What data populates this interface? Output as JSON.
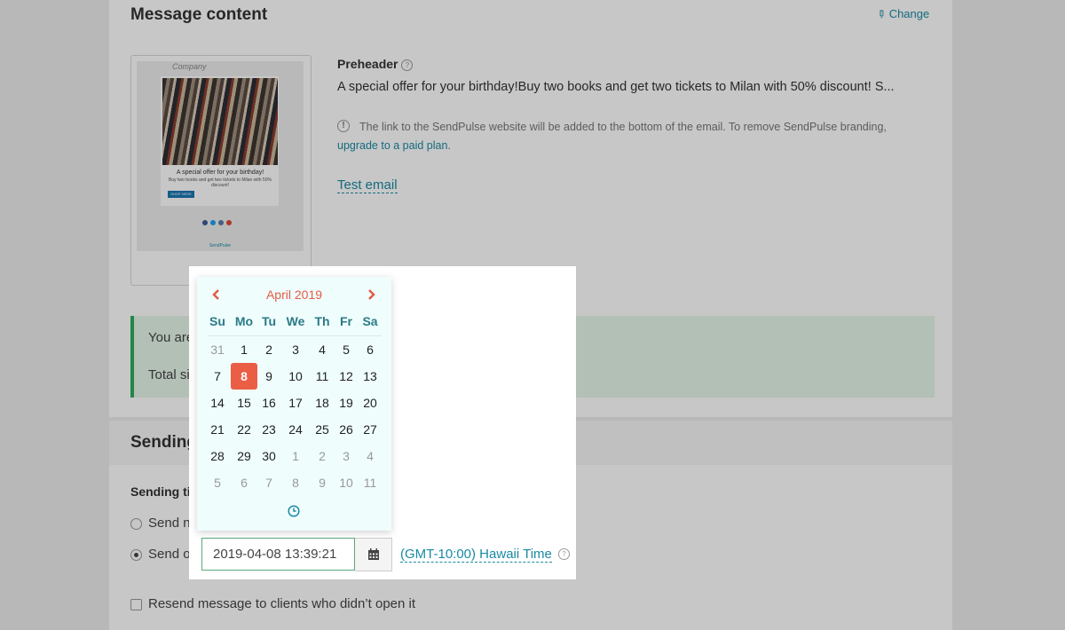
{
  "message_content": {
    "title": "Message content",
    "change_label": "Change",
    "preview": {
      "company": "Company",
      "heading": "A special offer for your birthday!",
      "body": "Buy two books and get two tickets to Milan with 50% discount!",
      "button": "SHOP HERE",
      "brand": "SendPulse"
    },
    "preheader_label": "Preheader",
    "preheader_text": "A special offer for your birthday!Buy two books and get two tickets to Milan with 50% discount! S...",
    "branding_notice": "The link to the SendPulse website will be added to the bottom of the email. To remove SendPulse branding,",
    "upgrade_link": "upgrade to a paid plan",
    "upgrade_suffix": ".",
    "test_email": "Test email"
  },
  "notice_box": {
    "line1": "You are g",
    "line2": "Total siz"
  },
  "sending": {
    "title": "Sending",
    "sending_time_label": "Sending tin",
    "send_now_label": "Send no",
    "send_on_label": "Send on",
    "datetime_value": "2019-04-08 13:39:21",
    "timezone": "(GMT-10:00) Hawaii Time",
    "resend_label": "Resend message to clients who didn’t open it"
  },
  "calendar": {
    "month_label": "April 2019",
    "weekdays": [
      "Su",
      "Mo",
      "Tu",
      "We",
      "Th",
      "Fr",
      "Sa"
    ],
    "weeks": [
      [
        "31",
        "1",
        "2",
        "3",
        "4",
        "5",
        "6"
      ],
      [
        "7",
        "8",
        "9",
        "10",
        "11",
        "12",
        "13"
      ],
      [
        "14",
        "15",
        "16",
        "17",
        "18",
        "19",
        "20"
      ],
      [
        "21",
        "22",
        "23",
        "24",
        "25",
        "26",
        "27"
      ],
      [
        "28",
        "29",
        "30",
        "1",
        "2",
        "3",
        "4"
      ],
      [
        "5",
        "6",
        "7",
        "8",
        "9",
        "10",
        "11"
      ]
    ],
    "selected_day": "8",
    "muted": [
      [
        0,
        0
      ],
      [
        4,
        3
      ],
      [
        4,
        4
      ],
      [
        4,
        5
      ],
      [
        4,
        6
      ],
      [
        5,
        0
      ],
      [
        5,
        1
      ],
      [
        5,
        2
      ],
      [
        5,
        3
      ],
      [
        5,
        4
      ],
      [
        5,
        5
      ],
      [
        5,
        6
      ]
    ]
  },
  "colors": {
    "accent": "#e55c45",
    "link": "#1a8aa3",
    "success": "#2fae5e"
  }
}
